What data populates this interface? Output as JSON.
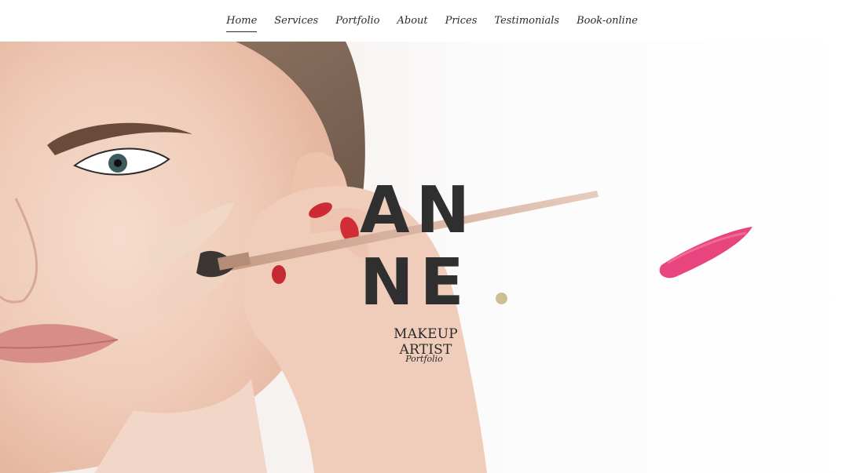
{
  "nav": {
    "items": [
      {
        "label": "Home",
        "active": true
      },
      {
        "label": "Services",
        "active": false
      },
      {
        "label": "Portfolio",
        "active": false
      },
      {
        "label": "About",
        "active": false
      },
      {
        "label": "Prices",
        "active": false
      },
      {
        "label": "Testimonials",
        "active": false
      },
      {
        "label": "Book-online",
        "active": false
      }
    ]
  },
  "hero": {
    "title_line1": "AN",
    "title_line2": "NE",
    "subtitle": "MAKEUP ARTIST",
    "link": "Portfolio",
    "accent_color": "#cdbf95",
    "swatch_color": "#e8457e"
  }
}
